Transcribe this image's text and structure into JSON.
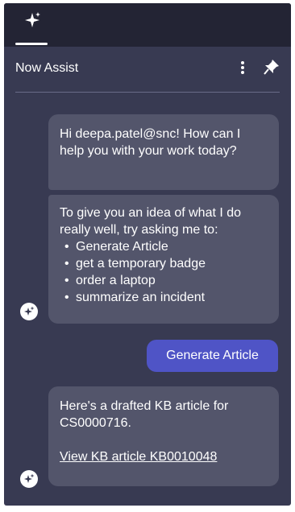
{
  "header": {
    "title": "Now Assist"
  },
  "tabs": [
    {
      "icon": "sparkle-icon",
      "active": true
    }
  ],
  "messages": [
    {
      "from": "assistant",
      "text": "Hi deepa.patel@snc! How can I help you with your work today?"
    },
    {
      "from": "assistant",
      "intro": "To give you an idea of what I do really well, try asking me to:",
      "suggestions": [
        "Generate Article",
        "get a temporary badge",
        "order a laptop",
        "summarize an incident"
      ]
    },
    {
      "from": "user",
      "text": "Generate Article"
    },
    {
      "from": "assistant",
      "text": "Here's a drafted KB article for CS0000716.",
      "link": "View KB article KB0010048"
    }
  ],
  "colors": {
    "panel": "#383a52",
    "topbar": "#232434",
    "bubble": "#53556b",
    "user_bubble": "#4f54c6"
  }
}
